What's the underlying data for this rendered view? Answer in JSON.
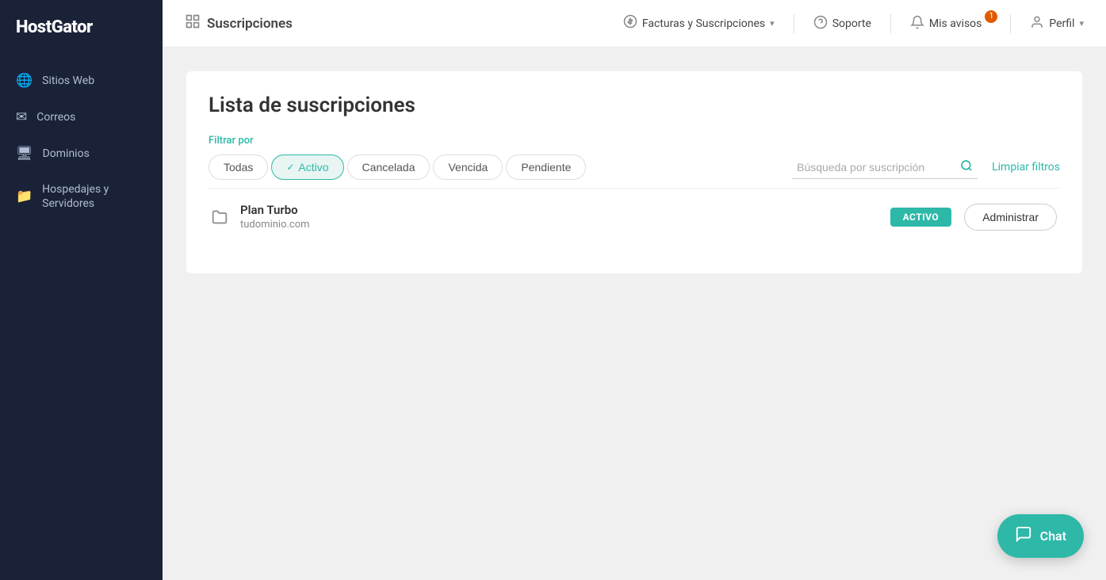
{
  "brand": {
    "name": "HostGator"
  },
  "sidebar": {
    "items": [
      {
        "id": "sitios-web",
        "label": "Sitios Web",
        "icon": "🌐"
      },
      {
        "id": "correos",
        "label": "Correos",
        "icon": "✉"
      },
      {
        "id": "dominios",
        "label": "Dominios",
        "icon": "🖥"
      },
      {
        "id": "hospedajes",
        "label": "Hospedajes y Servidores",
        "icon": "📁"
      }
    ]
  },
  "topnav": {
    "page_title": "Suscripciones",
    "page_title_icon": "≡",
    "menu_items": [
      {
        "id": "facturas",
        "label": "Facturas y Suscripciones",
        "has_chevron": true
      },
      {
        "id": "soporte",
        "label": "Soporte",
        "has_icon": true
      },
      {
        "id": "avisos",
        "label": "Mis avisos",
        "badge": "1"
      },
      {
        "id": "perfil",
        "label": "Perfil",
        "has_chevron": true
      }
    ]
  },
  "main": {
    "page_title": "Lista de suscripciones",
    "filter_label": "Filtrar por",
    "filters": [
      {
        "id": "todas",
        "label": "Todas",
        "active": false
      },
      {
        "id": "activo",
        "label": "Activo",
        "active": true
      },
      {
        "id": "cancelada",
        "label": "Cancelada",
        "active": false
      },
      {
        "id": "vencida",
        "label": "Vencida",
        "active": false
      },
      {
        "id": "pendiente",
        "label": "Pendiente",
        "active": false
      }
    ],
    "search_placeholder": "Búsqueda por suscripción",
    "clear_filters_label": "Limpiar filtros",
    "subscriptions": [
      {
        "id": "plan-turbo",
        "name": "Plan Turbo",
        "domain": "tudominio.com",
        "status": "ACTIVO",
        "admin_label": "Administrar"
      }
    ]
  },
  "chat": {
    "label": "Chat"
  }
}
